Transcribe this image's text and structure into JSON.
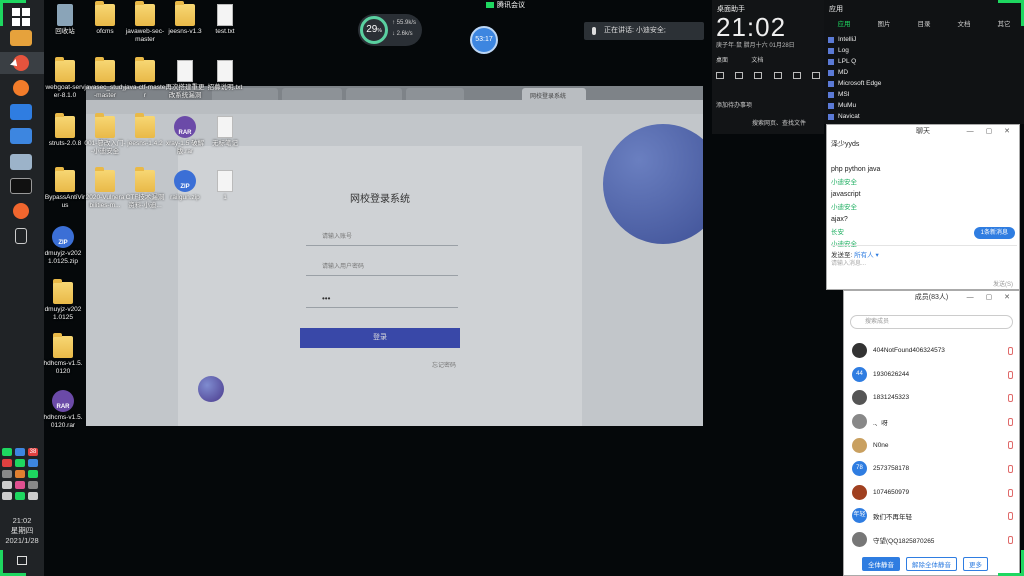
{
  "taskbar": {
    "time": "21:02",
    "weekday": "星期四",
    "date": "2021/1/28",
    "tray_num": "38"
  },
  "desktop_icons": [
    {
      "label": "回收站",
      "type": "bin"
    },
    {
      "label": "ofcms",
      "type": "folder"
    },
    {
      "label": "javaweb-sec-master",
      "type": "folder"
    },
    {
      "label": "jeesns-v1.3",
      "type": "folder"
    },
    {
      "label": "test.txt",
      "type": "doc"
    },
    {
      "label": "webgoat-server-8.1.0",
      "type": "folder"
    },
    {
      "label": "javasec_study-master",
      "type": "folder"
    },
    {
      "label": "java-ctf-master",
      "type": "folder"
    },
    {
      "label": "再次搭建重更改系统漏洞",
      "type": "doc"
    },
    {
      "label": "招募说明.txt",
      "type": "doc"
    },
    {
      "label": "struts-2.0.8",
      "type": "folder"
    },
    {
      "label": "001-篡改入门--小迪安全",
      "type": "folder"
    },
    {
      "label": "jeesns-1.4.2",
      "type": "folder"
    },
    {
      "label": "xray-1.5 破解版.rar",
      "type": "rar"
    },
    {
      "label": "无标笔记",
      "type": "doc"
    },
    {
      "label": "BypassAntiVirus",
      "type": "folder"
    },
    {
      "label": "2020-Vulnerabilities-m...",
      "type": "folder"
    },
    {
      "label": "CTF技术漏洞资料-小迪...",
      "type": "folder"
    },
    {
      "label": "railgun.zip",
      "type": "zip"
    },
    {
      "label": "1",
      "type": "doc"
    },
    {
      "label": "dmuyjz-v2021.0125.zip",
      "type": "zip"
    },
    {
      "label": "dmuyjz-v2021.0125",
      "type": "folder"
    },
    {
      "label": "hdhcms-v1.5.0120",
      "type": "folder"
    },
    {
      "label": "hdhcms-v1.5.0120.rar",
      "type": "rar"
    }
  ],
  "meeting": {
    "app_name": "腾讯会议",
    "cpu_percent": "29",
    "cpu_unit": "%",
    "net_up": "55.9k/s",
    "net_down": "2.6k/s",
    "timer": "53:17",
    "speaking_label": "正在讲话: 小迪安全;"
  },
  "browser": {
    "tabs": [
      "",
      "",
      "",
      "",
      "网校登录系统"
    ],
    "login_title": "网校登录系统",
    "username_placeholder": "请输入账号",
    "password_placeholder": "请输入用户密码",
    "captcha_value": "•••",
    "login_button": "登录",
    "forgot": "忘记密码"
  },
  "tile_panel": {
    "title": "桌面助手",
    "big_time": "21:02",
    "date_meta": "庚子年·鼠  腊月十六  01月28日",
    "row1": "桌面",
    "row2": "文档",
    "add_item": "添加待办事项",
    "search": "搜索网页、查找文件"
  },
  "apps_panel": {
    "title": "应用",
    "tabs": [
      "应用",
      "图片",
      "目录",
      "文档",
      "其它"
    ],
    "apps": [
      "IntelliJ",
      "Log",
      "LPL Q",
      "MD",
      "Microsoft Edge",
      "MSI",
      "MuMu",
      "Navicat"
    ]
  },
  "chat": {
    "title": "聊天",
    "messages": [
      {
        "who": "",
        "text": "泽少yyds"
      },
      {
        "who": "小迪安全",
        "text": "php python java"
      },
      {
        "who": "小迪安全",
        "text": "javascript"
      },
      {
        "who": "长安",
        "text": "ajax?"
      },
      {
        "who": "小迪安全",
        "text": ""
      }
    ],
    "new_msg_badge": "1条新消息",
    "send_to_label": "发送至:",
    "send_to_value": "所有人",
    "input_placeholder": "请输入消息...",
    "send_button": "发送(S)"
  },
  "members": {
    "title": "成员(83人)",
    "search_placeholder": "搜索成员",
    "list": [
      {
        "name": "404NotFound406324573",
        "color": "#333"
      },
      {
        "name": "1930626244",
        "color": "#2f7de1",
        "avatar": "44"
      },
      {
        "name": "1831245323",
        "color": "#555"
      },
      {
        "name": ".、呀",
        "color": "#888"
      },
      {
        "name": "N0ne",
        "color": "#c9a060"
      },
      {
        "name": "2573758178",
        "color": "#2f7de1",
        "avatar": "78"
      },
      {
        "name": "1074650979",
        "color": "#a04020"
      },
      {
        "name": "致们不再年轻",
        "color": "#2f7de1",
        "avatar": "年轻"
      },
      {
        "name": "守望(QQ1825870265",
        "color": "#777"
      }
    ],
    "mute_all": "全体静音",
    "unmute_all": "解除全体静音",
    "more": "更多"
  }
}
